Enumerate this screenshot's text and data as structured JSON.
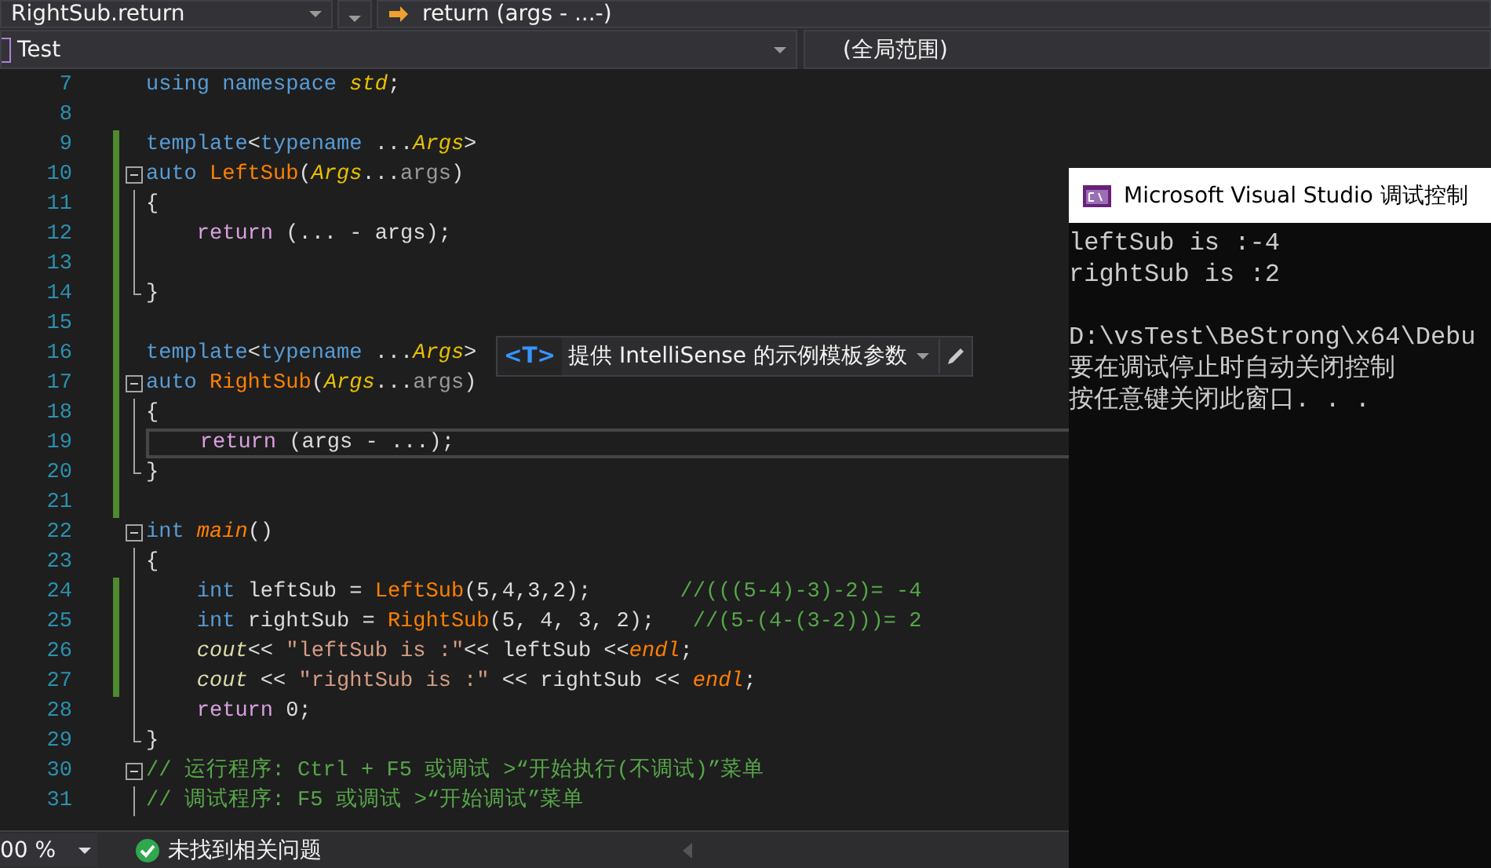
{
  "navigation_bar": {
    "member_dropdown": "RightSub.return",
    "scope_text": "return (args - ...-)"
  },
  "project_bar": {
    "project": "Test",
    "scope": "(全局范围)"
  },
  "editor": {
    "lines": [
      {
        "number": "7",
        "kind": "plain",
        "changed": false,
        "current": false,
        "t": [
          {
            "kind": "kw",
            "text": "using namespace"
          },
          {
            "kind": "tparam",
            "text": " std"
          },
          {
            "kind": "plain",
            "text": ";"
          }
        ]
      },
      {
        "number": "8",
        "kind": "plain",
        "changed": false,
        "current": false
      },
      {
        "number": "9",
        "kind": "plain",
        "changed": true,
        "current": false,
        "t": [
          {
            "kind": "kw",
            "text": "template"
          },
          {
            "kind": "plain",
            "text": "<"
          },
          {
            "kind": "kw",
            "text": "typename"
          },
          {
            "kind": "plain",
            "text": " ..."
          },
          {
            "kind": "tparam",
            "text": "Args"
          },
          {
            "kind": "plain",
            "text": ">"
          }
        ]
      },
      {
        "number": "10",
        "kind": "open",
        "changed": true,
        "current": false,
        "t": [
          {
            "kind": "kw",
            "text": "auto"
          },
          {
            "kind": "fn",
            "text": " LeftSub"
          },
          {
            "kind": "plain",
            "text": "("
          },
          {
            "kind": "tparam",
            "text": "Args"
          },
          {
            "kind": "plain",
            "text": "..."
          },
          {
            "kind": "param",
            "text": "args"
          },
          {
            "kind": "plain",
            "text": ")"
          }
        ]
      },
      {
        "number": "11",
        "kind": "inner",
        "changed": true,
        "current": false,
        "t": [
          {
            "kind": "plain",
            "text": "{"
          }
        ]
      },
      {
        "number": "12",
        "kind": "inner",
        "changed": true,
        "current": false,
        "t": [
          {
            "kind": "ctrl",
            "text": "    return"
          },
          {
            "kind": "plain",
            "text": " (... - args);"
          }
        ]
      },
      {
        "number": "13",
        "kind": "inner",
        "changed": true,
        "current": false
      },
      {
        "number": "14",
        "kind": "end",
        "changed": true,
        "current": false,
        "t": [
          {
            "kind": "plain",
            "text": "}"
          }
        ]
      },
      {
        "number": "15",
        "kind": "plain",
        "changed": true,
        "current": false
      },
      {
        "number": "16",
        "kind": "plain",
        "changed": true,
        "current": false,
        "t": [
          {
            "kind": "kw",
            "text": "template"
          },
          {
            "kind": "plain",
            "text": "<"
          },
          {
            "kind": "kw",
            "text": "typename"
          },
          {
            "kind": "plain",
            "text": " ..."
          },
          {
            "kind": "tparam",
            "text": "Args"
          },
          {
            "kind": "plain",
            "text": ">"
          }
        ]
      },
      {
        "number": "17",
        "kind": "open",
        "changed": true,
        "current": false,
        "t": [
          {
            "kind": "kw",
            "text": "auto"
          },
          {
            "kind": "fn",
            "text": " RightSub"
          },
          {
            "kind": "plain",
            "text": "("
          },
          {
            "kind": "tparam",
            "text": "Args"
          },
          {
            "kind": "plain",
            "text": "..."
          },
          {
            "kind": "param",
            "text": "args"
          },
          {
            "kind": "plain",
            "text": ")"
          }
        ]
      },
      {
        "number": "18",
        "kind": "inner",
        "changed": true,
        "current": false,
        "t": [
          {
            "kind": "plain",
            "text": "{"
          }
        ]
      },
      {
        "number": "19",
        "kind": "inner",
        "changed": true,
        "current": true,
        "t": [
          {
            "kind": "ctrl",
            "text": "    return"
          },
          {
            "kind": "plain",
            "text": " (args - ...);"
          }
        ]
      },
      {
        "number": "20",
        "kind": "end",
        "changed": true,
        "current": false,
        "t": [
          {
            "kind": "plain",
            "text": "}"
          }
        ]
      },
      {
        "number": "21",
        "kind": "plain",
        "changed": true,
        "current": false
      },
      {
        "number": "22",
        "kind": "open",
        "changed": false,
        "current": false,
        "t": [
          {
            "kind": "kw",
            "text": "int"
          },
          {
            "kind": "fnit",
            "text": " main"
          },
          {
            "kind": "plain",
            "text": "()"
          }
        ]
      },
      {
        "number": "23",
        "kind": "inner",
        "changed": false,
        "current": false,
        "t": [
          {
            "kind": "plain",
            "text": "{"
          }
        ]
      },
      {
        "number": "24",
        "kind": "inner",
        "changed": true,
        "current": false,
        "t": [
          {
            "kind": "kw",
            "text": "    int"
          },
          {
            "kind": "plain",
            "text": " leftSub = "
          },
          {
            "kind": "fn",
            "text": "LeftSub"
          },
          {
            "kind": "plain",
            "text": "(5,4,3,2);"
          },
          {
            "kind": "cm",
            "text": "       //(((5-4)-3)-2)= -4"
          }
        ]
      },
      {
        "number": "25",
        "kind": "inner",
        "changed": true,
        "current": false,
        "t": [
          {
            "kind": "kw",
            "text": "    int"
          },
          {
            "kind": "plain",
            "text": " rightSub = "
          },
          {
            "kind": "fn",
            "text": "RightSub"
          },
          {
            "kind": "plain",
            "text": "(5, 4, 3, 2);"
          },
          {
            "kind": "cm",
            "text": "   //(5-(4-(3-2)))= 2"
          }
        ]
      },
      {
        "number": "26",
        "kind": "inner",
        "changed": true,
        "current": false,
        "t": [
          {
            "kind": "obj",
            "text": "    cout"
          },
          {
            "kind": "plain",
            "text": "<< "
          },
          {
            "kind": "str",
            "text": "\"leftSub is :\""
          },
          {
            "kind": "plain",
            "text": "<< leftSub <<"
          },
          {
            "kind": "fnit",
            "text": "endl"
          },
          {
            "kind": "plain",
            "text": ";"
          }
        ]
      },
      {
        "number": "27",
        "kind": "inner",
        "changed": true,
        "current": false,
        "t": [
          {
            "kind": "obj",
            "text": "    cout"
          },
          {
            "kind": "plain",
            "text": " << "
          },
          {
            "kind": "str",
            "text": "\"rightSub is :\""
          },
          {
            "kind": "plain",
            "text": " << rightSub << "
          },
          {
            "kind": "fnit",
            "text": "endl"
          },
          {
            "kind": "plain",
            "text": ";"
          }
        ]
      },
      {
        "number": "28",
        "kind": "inner",
        "changed": false,
        "current": false,
        "t": [
          {
            "kind": "ctrl",
            "text": "    return"
          },
          {
            "kind": "plain",
            "text": " 0;"
          }
        ]
      },
      {
        "number": "29",
        "kind": "end",
        "changed": false,
        "current": false,
        "t": [
          {
            "kind": "plain",
            "text": "}"
          }
        ]
      },
      {
        "number": "30",
        "kind": "open",
        "changed": false,
        "current": false,
        "t": [
          {
            "kind": "cm",
            "text": "// 运行程序: Ctrl + F5 或调试 >“开始执行(不调试)”菜单"
          }
        ]
      },
      {
        "number": "31",
        "kind": "inner",
        "changed": false,
        "current": false,
        "t": [
          {
            "kind": "cm",
            "text": "// 调试程序: F5 或调试 >“开始调试”菜单"
          }
        ]
      }
    ],
    "hint": {
      "tag": "<T>",
      "text": "提供 IntelliSense 的示例模板参数"
    }
  },
  "status_bar": {
    "zoom": "00 %",
    "issues": "未找到相关问题"
  },
  "console": {
    "title": "Microsoft Visual Studio 调试控制",
    "paragraphs": [
      [
        "leftSub is :-4",
        "rightSub is :2"
      ],
      [
        "D:\\vsTest\\BeStrong\\x64\\Debu",
        "要在调试停止时自动关闭控制",
        "按任意键关闭此窗口. . ."
      ]
    ]
  }
}
